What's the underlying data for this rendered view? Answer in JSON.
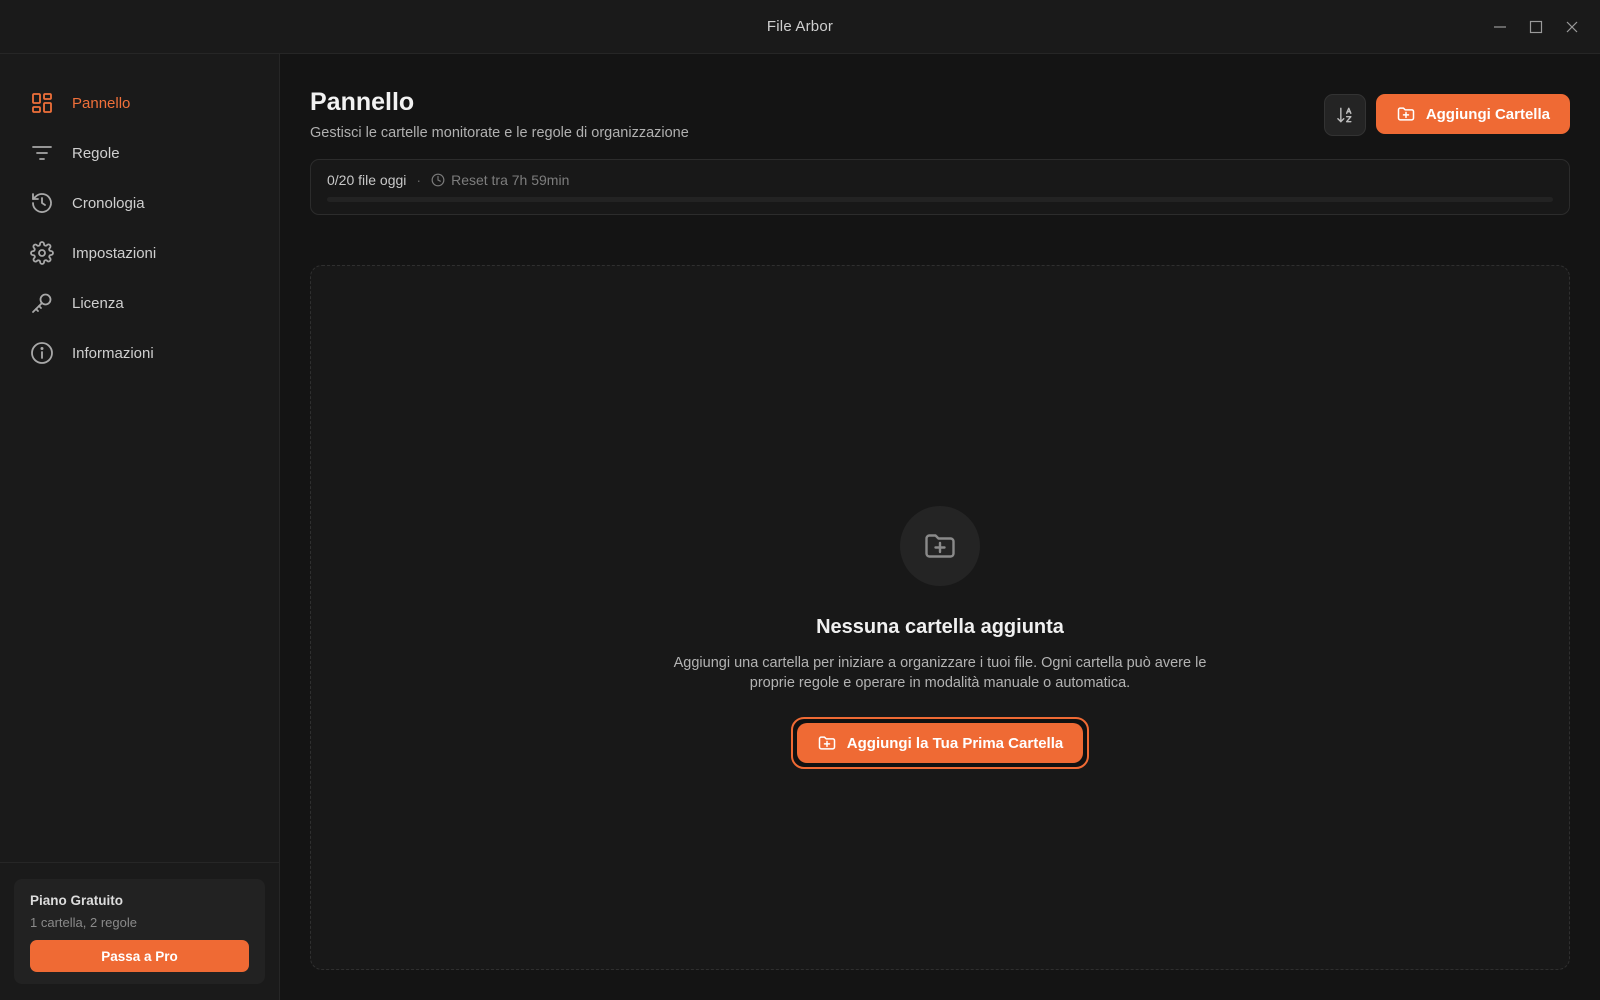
{
  "window": {
    "title": "File Arbor"
  },
  "sidebar": {
    "items": [
      {
        "label": "Pannello",
        "icon": "dashboard-icon",
        "active": true
      },
      {
        "label": "Regole",
        "icon": "filter-icon",
        "active": false
      },
      {
        "label": "Cronologia",
        "icon": "history-icon",
        "active": false
      },
      {
        "label": "Impostazioni",
        "icon": "gear-icon",
        "active": false
      },
      {
        "label": "Licenza",
        "icon": "key-icon",
        "active": false
      },
      {
        "label": "Informazioni",
        "icon": "info-icon",
        "active": false
      }
    ],
    "plan": {
      "title": "Piano Gratuito",
      "subtitle": "1 cartella, 2 regole",
      "button": "Passa a Pro"
    }
  },
  "main": {
    "title": "Pannello",
    "subtitle": "Gestisci le cartelle monitorate e le regole di organizzazione",
    "add_button": "Aggiungi Cartella",
    "sort_icon": "sort-az-icon",
    "usage": {
      "count": "0/20 file oggi",
      "reset": "Reset tra 7h 59min",
      "progress_fraction": 0
    },
    "empty": {
      "title": "Nessuna cartella aggiunta",
      "description": "Aggiungi una cartella per iniziare a organizzare i tuoi file. Ogni cartella può avere le proprie regole e operare in modalità manuale o automatica.",
      "button": "Aggiungi la Tua Prima Cartella"
    }
  },
  "colors": {
    "accent": "#ef6a34",
    "background": "#141414",
    "sidebar": "#1a1a1a"
  }
}
